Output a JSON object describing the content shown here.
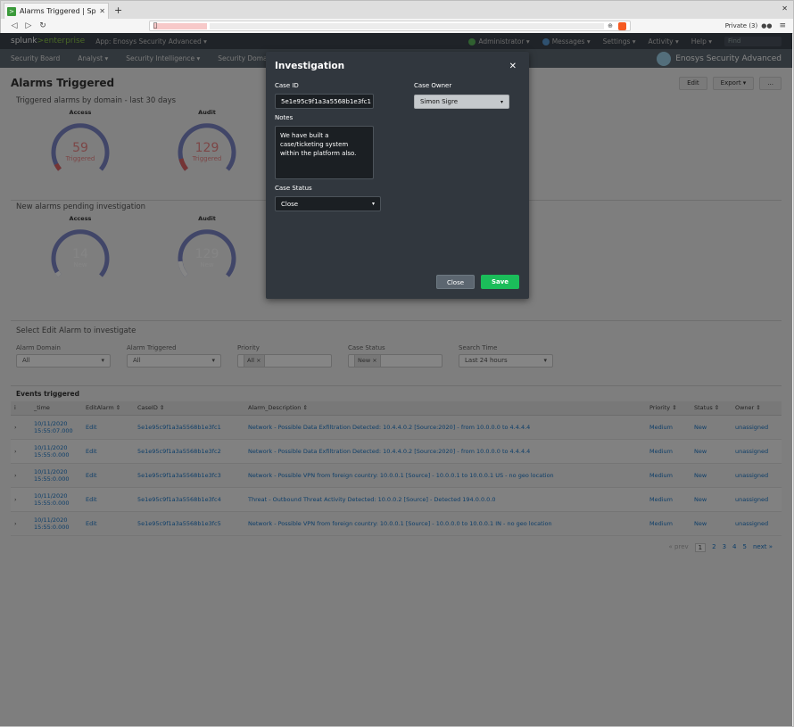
{
  "browser": {
    "tab_title": "Alarms Triggered | Splunk",
    "new_tab": "+",
    "window_close": "✕",
    "private_label": "Private (3)",
    "url_zoom": "⊕"
  },
  "splunk": {
    "logo_a": "splunk",
    "logo_b": ">enterprise",
    "app_label": "App: Enosys Security Advanced ▾",
    "top_menu": [
      "Administrator ▾",
      "Messages ▾",
      "Settings ▾",
      "Activity ▾",
      "Help ▾"
    ],
    "find_placeholder": "Find",
    "nav_items": [
      "Security Board",
      "Analyst ▾",
      "Security Intelligence ▾",
      "Security Domains ▾"
    ],
    "brand": "Enosys Security Advanced"
  },
  "dashboard": {
    "title": "Alarms Triggered",
    "edit": "Edit",
    "export": "Export ▾",
    "more": "...",
    "panel1_title": "Triggered alarms by domain - last 30 days",
    "panel1_gauges": [
      {
        "label": "Access",
        "value": "59",
        "sub": "Triggered"
      },
      {
        "label": "Audit",
        "value": "129",
        "sub": "Triggered"
      }
    ],
    "panel2_title": "New alarms pending investigation",
    "panel2_gauges": [
      {
        "label": "Access",
        "value": "14",
        "sub": "New"
      },
      {
        "label": "Audit",
        "value": "129",
        "sub": "New"
      }
    ],
    "panel3_title": "Select Edit Alarm to investigate",
    "filters": [
      {
        "label": "Alarm Domain",
        "value": "All"
      },
      {
        "label": "Alarm Triggered",
        "value": "All"
      },
      {
        "label": "Priority",
        "value": "All ×"
      },
      {
        "label": "Case Status",
        "value": "New ×"
      },
      {
        "label": "Search Time",
        "value": "Last 24 hours"
      }
    ],
    "events_title": "Events triggered",
    "columns": [
      "i",
      "_time",
      "EditAlarm ⇕",
      "CaseID ⇕",
      "Alarm_Description ⇕",
      "Priority ⇕",
      "Status ⇕",
      "Owner ⇕"
    ],
    "rows": [
      {
        "time": "10/11/2020 15:55:07.000",
        "edit": "Edit",
        "case": "5e1e95c9f1a3a5568b1e3fc1",
        "desc": "Network - Possible Data Exfiltration Detected: 10.4.4.0.2 [Source:2020] - from 10.0.0.0 to 4.4.4.4",
        "priority": "Medium",
        "status": "New",
        "owner": "unassigned"
      },
      {
        "time": "10/11/2020 15:55:0.000",
        "edit": "Edit",
        "case": "5e1e95c9f1a3a5568b1e3fc2",
        "desc": "Network - Possible Data Exfiltration Detected: 10.4.4.0.2 [Source:2020] - from 10.0.0.0 to 4.4.4.4",
        "priority": "Medium",
        "status": "New",
        "owner": "unassigned"
      },
      {
        "time": "10/11/2020 15:55:0.000",
        "edit": "Edit",
        "case": "5e1e95c9f1a3a5568b1e3fc3",
        "desc": "Network - Possible VPN from foreign country: 10.0.0.1 [Source] - 10.0.0.1 to 10.0.0.1 US - no geo location",
        "priority": "Medium",
        "status": "New",
        "owner": "unassigned"
      },
      {
        "time": "10/11/2020 15:55:0.000",
        "edit": "Edit",
        "case": "5e1e95c9f1a3a5568b1e3fc4",
        "desc": "Threat - Outbound Threat Activity Detected: 10.0.0.2 [Source] - Detected 194.0.0.0.0",
        "priority": "Medium",
        "status": "New",
        "owner": "unassigned"
      },
      {
        "time": "10/11/2020 15:55:0.000",
        "edit": "Edit",
        "case": "5e1e95c9f1a3a5568b1e3fc5",
        "desc": "Network - Possible VPN from foreign country: 10.0.0.1 [Source] - 10.0.0.0 to 10.0.0.1 IN - no geo location",
        "priority": "Medium",
        "status": "New",
        "owner": "unassigned"
      }
    ],
    "pager": {
      "prev": "« prev",
      "pages": [
        "1",
        "2",
        "3",
        "4",
        "5"
      ],
      "next": "next »"
    }
  },
  "modal": {
    "title": "Investigation",
    "close_icon": "✕",
    "case_id_label": "Case ID",
    "case_id_value": "5e1e95c9f1a3a5568b1e3fc1",
    "case_owner_label": "Case Owner",
    "case_owner_value": "Simon Sigre",
    "notes_label": "Notes",
    "notes_value": "We have built a case/ticketing system within the platform also.",
    "case_status_label": "Case Status",
    "case_status_value": "Close",
    "close_button": "Close",
    "save_button": "Save"
  }
}
